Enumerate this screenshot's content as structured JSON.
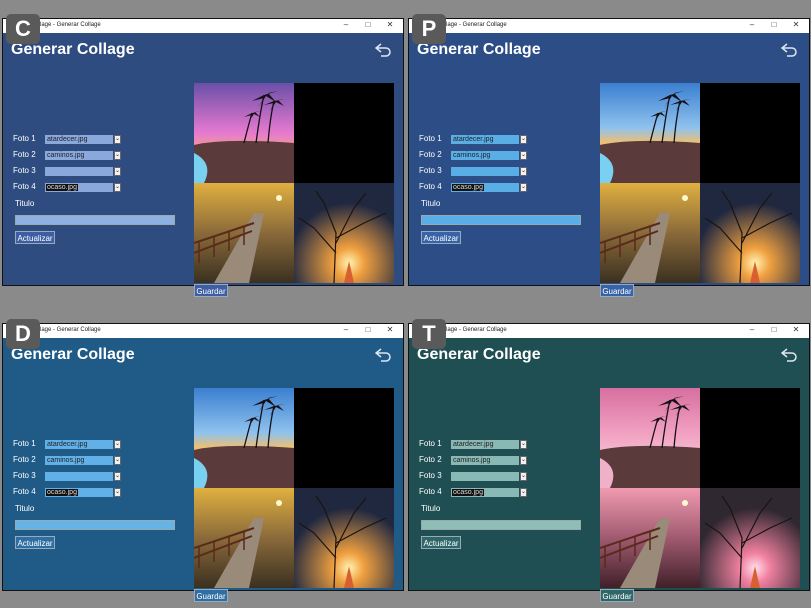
{
  "window": {
    "title": "Collage - Generar Collage",
    "minimize": "–",
    "maximize": "□",
    "close": "✕"
  },
  "app": {
    "heading": "Generar Collage",
    "photo_labels": [
      "Foto 1",
      "Foto 2",
      "Foto 3",
      "Foto 4"
    ],
    "photo_values": [
      "atardecer.jpg",
      "caminos.jpg",
      "",
      "ocaso.jpg"
    ],
    "title_label": "Titulo",
    "title_value": "",
    "update_button": "Actualizar",
    "save_button": "Guardar",
    "back_icon": "undo-arrow-icon"
  },
  "panels": [
    {
      "badge": "C",
      "colors": {
        "bg": "#2e4c80",
        "combo": "#8aa8dc",
        "input": "#8fb1e2",
        "button": "#3d5ea3"
      }
    },
    {
      "badge": "P",
      "colors": {
        "bg": "#2c4d86",
        "combo": "#5aaee6",
        "input": "#59aee8",
        "button": "#3763a8"
      }
    },
    {
      "badge": "D",
      "colors": {
        "bg": "#1f5b86",
        "combo": "#62b0e8",
        "input": "#66b3e8",
        "button": "#2e6ea0"
      }
    },
    {
      "badge": "T",
      "colors": {
        "bg": "#1f4f52",
        "combo": "#8ab8b4",
        "input": "#8fbdb8",
        "button": "#2f6668"
      }
    }
  ]
}
